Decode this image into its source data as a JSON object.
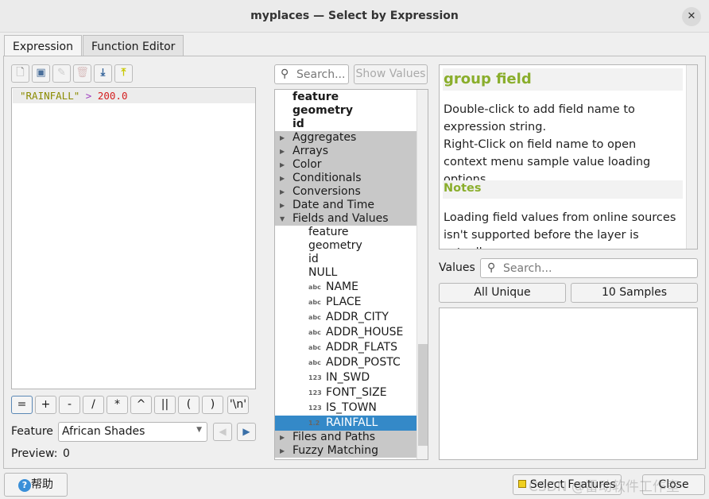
{
  "window": {
    "title": "myplaces — Select by Expression",
    "close_icon": "close-icon"
  },
  "tabs": [
    {
      "label": "Expression",
      "active": true
    },
    {
      "label": "Function Editor",
      "active": false
    }
  ],
  "toolbar": {
    "icons": [
      "new-file-icon",
      "save-icon",
      "edit-icon",
      "delete-icon",
      "import-icon",
      "export-icon"
    ]
  },
  "expression": {
    "field": "\"RAINFALL\"",
    "operator": ">",
    "value": "200.0"
  },
  "operators": [
    "=",
    "+",
    "-",
    "/",
    "*",
    "^",
    "||",
    "(",
    ")",
    "'\\n'"
  ],
  "feature": {
    "label": "Feature",
    "value": "African Shades"
  },
  "preview": {
    "label": "Preview:",
    "value": "0"
  },
  "search": {
    "placeholder": "Search...",
    "show_values": "Show Values"
  },
  "tree": {
    "top": [
      "feature",
      "geometry",
      "id"
    ],
    "groups_before": [
      "Aggregates",
      "Arrays",
      "Color",
      "Conditionals",
      "Conversions",
      "Date and Time"
    ],
    "expanded_group": "Fields and Values",
    "plain_children": [
      "feature",
      "geometry",
      "id",
      "NULL"
    ],
    "fields": [
      {
        "type": "abc",
        "name": "NAME"
      },
      {
        "type": "abc",
        "name": "PLACE"
      },
      {
        "type": "abc",
        "name": "ADDR_CITY"
      },
      {
        "type": "abc",
        "name": "ADDR_HOUSE"
      },
      {
        "type": "abc",
        "name": "ADDR_FLATS"
      },
      {
        "type": "abc",
        "name": "ADDR_POSTC"
      },
      {
        "type": "123",
        "name": "IN_SWD"
      },
      {
        "type": "123",
        "name": "FONT_SIZE"
      },
      {
        "type": "123",
        "name": "IS_TOWN"
      },
      {
        "type": "1.2",
        "name": "RAINFALL",
        "selected": true
      }
    ],
    "groups_after": [
      "Files and Paths",
      "Fuzzy Matching"
    ]
  },
  "help": {
    "title": "group field",
    "line1": "Double-click to add field name to expression string.",
    "line2": "Right-Click on field name to open context menu sample value loading options.",
    "notes_title": "Notes",
    "notes": "Loading field values from online sources isn't supported before the layer is actually"
  },
  "values": {
    "label": "Values",
    "placeholder": "Search...",
    "all_unique": "All Unique",
    "samples": "10 Samples"
  },
  "footer": {
    "help": "帮助",
    "select": "Select Features",
    "close": "Close"
  },
  "watermark": "CSDN @雷动软件工作室",
  "colors": {
    "accent": "#3489c8",
    "help_heading": "#8aae2c",
    "string": "#8b8b00",
    "operator": "#a040c0",
    "number": "#d42020"
  }
}
